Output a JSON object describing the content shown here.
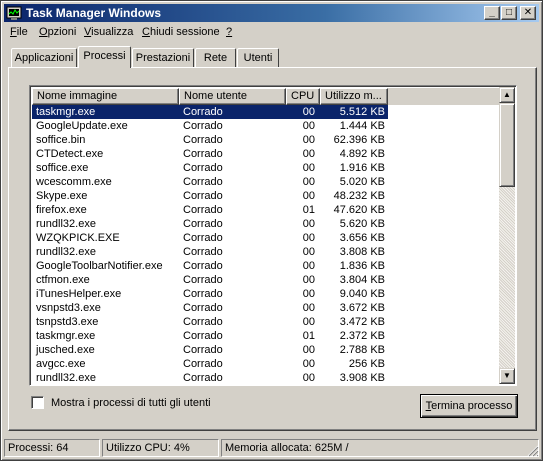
{
  "window": {
    "title": "Task Manager Windows",
    "controls": {
      "minimize": "_",
      "maximize": "□",
      "close": "✕"
    }
  },
  "menu": {
    "items": [
      {
        "label": "File",
        "mnemonic_label": "F",
        "rest": "ile"
      },
      {
        "label": "Opzioni",
        "mnemonic_label": "O",
        "rest": "pzioni"
      },
      {
        "label": "Visualizza",
        "mnemonic_label": "V",
        "rest": "isualizza"
      },
      {
        "label": "Chiudi sessione",
        "mnemonic_label": "C",
        "rest": "hiudi sessione"
      },
      {
        "label": "?",
        "mnemonic_label": "?",
        "rest": ""
      }
    ]
  },
  "tabs": {
    "applicazioni": "Applicazioni",
    "processi": "Processi",
    "prestazioni": "Prestazioni",
    "rete": "Rete",
    "utenti": "Utenti",
    "active": "Processi"
  },
  "table": {
    "columns": {
      "name": "Nome immagine",
      "user": "Nome utente",
      "cpu": "CPU",
      "mem": "Utilizzo m..."
    },
    "selected_index": 0,
    "rows": [
      {
        "name": "taskmgr.exe",
        "user": "Corrado",
        "cpu": "00",
        "mem": "5.512 KB"
      },
      {
        "name": "GoogleUpdate.exe",
        "user": "Corrado",
        "cpu": "00",
        "mem": "1.444 KB"
      },
      {
        "name": "soffice.bin",
        "user": "Corrado",
        "cpu": "00",
        "mem": "62.396 KB"
      },
      {
        "name": "CTDetect.exe",
        "user": "Corrado",
        "cpu": "00",
        "mem": "4.892 KB"
      },
      {
        "name": "soffice.exe",
        "user": "Corrado",
        "cpu": "00",
        "mem": "1.916 KB"
      },
      {
        "name": "wcescomm.exe",
        "user": "Corrado",
        "cpu": "00",
        "mem": "5.020 KB"
      },
      {
        "name": "Skype.exe",
        "user": "Corrado",
        "cpu": "00",
        "mem": "48.232 KB"
      },
      {
        "name": "firefox.exe",
        "user": "Corrado",
        "cpu": "01",
        "mem": "47.620 KB"
      },
      {
        "name": "rundll32.exe",
        "user": "Corrado",
        "cpu": "00",
        "mem": "5.620 KB"
      },
      {
        "name": "WZQKPICK.EXE",
        "user": "Corrado",
        "cpu": "00",
        "mem": "3.656 KB"
      },
      {
        "name": "rundll32.exe",
        "user": "Corrado",
        "cpu": "00",
        "mem": "3.808 KB"
      },
      {
        "name": "GoogleToolbarNotifier.exe",
        "user": "Corrado",
        "cpu": "00",
        "mem": "1.836 KB"
      },
      {
        "name": "ctfmon.exe",
        "user": "Corrado",
        "cpu": "00",
        "mem": "3.804 KB"
      },
      {
        "name": "iTunesHelper.exe",
        "user": "Corrado",
        "cpu": "00",
        "mem": "9.040 KB"
      },
      {
        "name": "vsnpstd3.exe",
        "user": "Corrado",
        "cpu": "00",
        "mem": "3.672 KB"
      },
      {
        "name": "tsnpstd3.exe",
        "user": "Corrado",
        "cpu": "00",
        "mem": "3.472 KB"
      },
      {
        "name": "taskmgr.exe",
        "user": "Corrado",
        "cpu": "01",
        "mem": "2.372 KB"
      },
      {
        "name": "jusched.exe",
        "user": "Corrado",
        "cpu": "00",
        "mem": "2.788 KB"
      },
      {
        "name": "avgcc.exe",
        "user": "Corrado",
        "cpu": "00",
        "mem": "256 KB"
      },
      {
        "name": "rundll32.exe",
        "user": "Corrado",
        "cpu": "00",
        "mem": "3.908 KB"
      }
    ]
  },
  "show_all_processes": {
    "label": "Mostra i processi di tutti gli utenti",
    "checked": false
  },
  "end_process_button": {
    "mnemonic": "T",
    "rest": "ermina processo"
  },
  "status": {
    "processes": "Processi: 64",
    "cpu": "Utilizzo CPU: 4%",
    "memory": "Memoria allocata: 625M /"
  },
  "icons": {
    "app": "task-manager-icon",
    "scroll_up": "▲",
    "scroll_down": "▼"
  },
  "colors": {
    "titlebar_start": "#0a246a",
    "titlebar_end": "#a6caf0",
    "face": "#d4d0c8",
    "selection": "#0a246a"
  }
}
